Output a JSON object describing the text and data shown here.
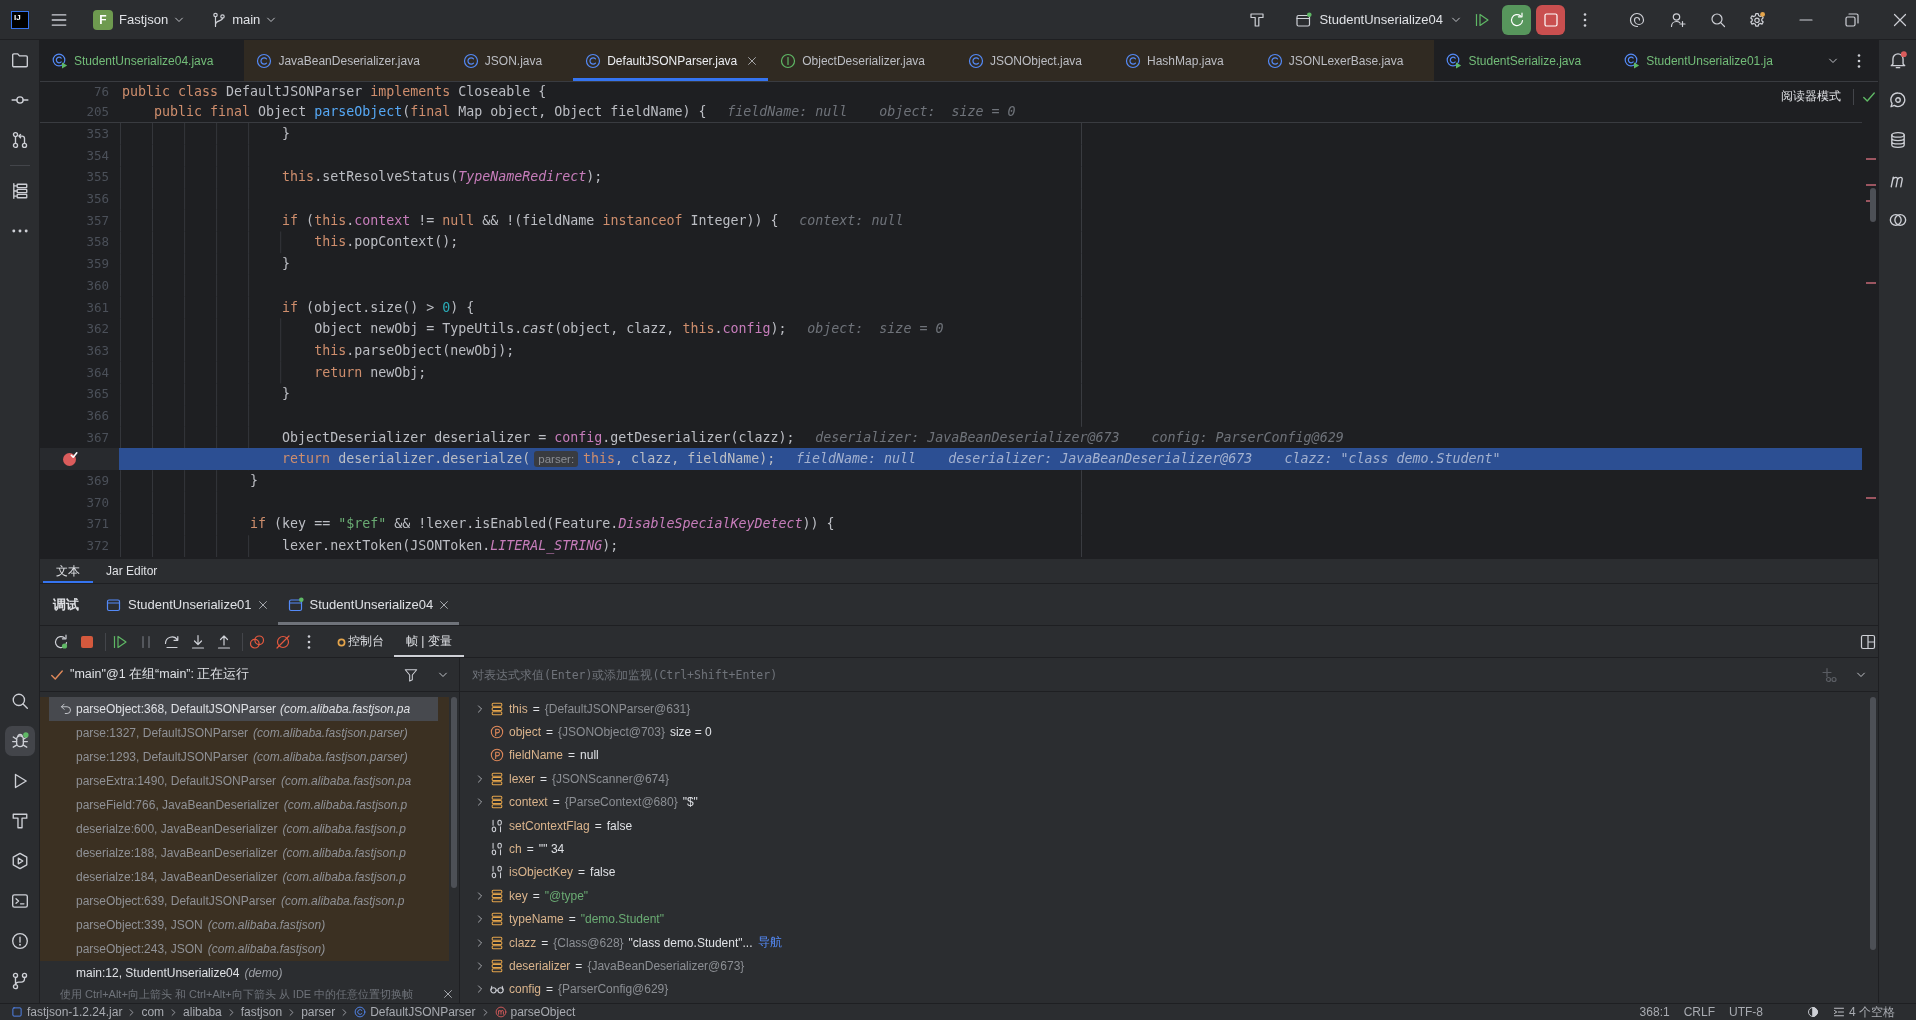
{
  "title_bar": {
    "logo": "IJ",
    "project_initial": "F",
    "project": "Fastjson",
    "branch": "main",
    "run_config": "StudentUnserialize04"
  },
  "tool_strip": {
    "top": [
      {
        "selected": false
      },
      {
        "selected": false
      },
      {
        "selected": false
      },
      {
        "selected": false
      },
      {
        "selected": false
      }
    ],
    "bottom": [
      {
        "selected": false
      },
      {
        "selected": true
      },
      {
        "selected": false
      },
      {
        "selected": false
      },
      {
        "selected": false
      },
      {
        "selected": false
      },
      {
        "selected": false
      },
      {
        "selected": false
      }
    ]
  },
  "editor_tabs": [
    {
      "label": "StudentUnserialize04.java",
      "kind": "runnable",
      "library": false,
      "selected": false
    },
    {
      "label": "JavaBeanDeserializer.java",
      "kind": "class",
      "library": true,
      "selected": false
    },
    {
      "label": "JSON.java",
      "kind": "class",
      "library": true,
      "selected": false
    },
    {
      "label": "DefaultJSONParser.java",
      "kind": "class",
      "library": true,
      "selected": true
    },
    {
      "label": "ObjectDeserializer.java",
      "kind": "interface",
      "library": true,
      "selected": false
    },
    {
      "label": "JSONObject.java",
      "kind": "class",
      "library": true,
      "selected": false
    },
    {
      "label": "HashMap.java",
      "kind": "class",
      "library": true,
      "selected": false
    },
    {
      "label": "JSONLexerBase.java",
      "kind": "class",
      "library": true,
      "selected": false
    },
    {
      "label": "StudentSerialize.java",
      "kind": "runnable",
      "library": false,
      "selected": false
    },
    {
      "label": "StudentUnserialize01.ja",
      "kind": "runnable",
      "library": false,
      "selected": false
    }
  ],
  "editor": {
    "reader_mode": "阅读器模式",
    "sticky_lines": [
      {
        "number": "76",
        "tokens": [
          {
            "kind": "keyword",
            "text": "public class"
          },
          {
            "kind": "plain",
            "text": " DefaultJSONParser "
          },
          {
            "kind": "keyword",
            "text": "implements"
          },
          {
            "kind": "plain",
            "text": " Closeable {"
          }
        ]
      },
      {
        "number": "205",
        "tokens": [
          {
            "kind": "keyword",
            "text": "    public final"
          },
          {
            "kind": "plain",
            "text": " Object "
          },
          {
            "kind": "method",
            "text": "parseObject"
          },
          {
            "kind": "plain",
            "text": "("
          },
          {
            "kind": "keyword",
            "text": "final"
          },
          {
            "kind": "plain",
            "text": " Map object, Object fieldName) {"
          }
        ],
        "hints": [
          "fieldName: null",
          "object:  size = 0"
        ]
      }
    ],
    "lines": [
      {
        "number": "353",
        "current": false,
        "breakpoint": false,
        "tokens": [
          {
            "kind": "plain",
            "text": "                    }"
          }
        ]
      },
      {
        "number": "354",
        "current": false,
        "breakpoint": false
      },
      {
        "number": "355",
        "current": false,
        "breakpoint": false,
        "tokens": [
          {
            "kind": "keyword",
            "text": "                    this"
          },
          {
            "kind": "plain",
            "text": ".setResolveStatus("
          },
          {
            "kind": "static",
            "text": "TypeNameRedirect"
          },
          {
            "kind": "plain",
            "text": ");"
          }
        ]
      },
      {
        "number": "356",
        "current": false,
        "breakpoint": false
      },
      {
        "number": "357",
        "current": false,
        "breakpoint": false,
        "tokens": [
          {
            "kind": "keyword",
            "text": "                    if"
          },
          {
            "kind": "plain",
            "text": " ("
          },
          {
            "kind": "keyword",
            "text": "this"
          },
          {
            "kind": "plain",
            "text": "."
          },
          {
            "kind": "field",
            "text": "context"
          },
          {
            "kind": "plain",
            "text": " != "
          },
          {
            "kind": "keyword",
            "text": "null"
          },
          {
            "kind": "plain",
            "text": " && !(fieldName "
          },
          {
            "kind": "keyword",
            "text": "instanceof"
          },
          {
            "kind": "plain",
            "text": " Integer)) {"
          }
        ],
        "hints": [
          "context: null"
        ]
      },
      {
        "number": "358",
        "current": false,
        "breakpoint": false,
        "tokens": [
          {
            "kind": "keyword",
            "text": "                        this"
          },
          {
            "kind": "plain",
            "text": ".popContext();"
          }
        ]
      },
      {
        "number": "359",
        "current": false,
        "breakpoint": false,
        "tokens": [
          {
            "kind": "plain",
            "text": "                    }"
          }
        ]
      },
      {
        "number": "360",
        "current": false,
        "breakpoint": false
      },
      {
        "number": "361",
        "current": false,
        "breakpoint": false,
        "tokens": [
          {
            "kind": "keyword",
            "text": "                    if"
          },
          {
            "kind": "plain",
            "text": " (object.size() > "
          },
          {
            "kind": "number",
            "text": "0"
          },
          {
            "kind": "plain",
            "text": ") {"
          }
        ]
      },
      {
        "number": "362",
        "current": false,
        "breakpoint": false,
        "tokens": [
          {
            "kind": "plain",
            "text": "                        Object newObj = TypeUtils."
          },
          {
            "kind": "italic",
            "text": "cast"
          },
          {
            "kind": "plain",
            "text": "(object, clazz, "
          },
          {
            "kind": "keyword",
            "text": "this"
          },
          {
            "kind": "plain",
            "text": "."
          },
          {
            "kind": "field",
            "text": "config"
          },
          {
            "kind": "plain",
            "text": ");"
          }
        ],
        "hints": [
          "object:  size = 0"
        ]
      },
      {
        "number": "363",
        "current": false,
        "breakpoint": false,
        "tokens": [
          {
            "kind": "keyword",
            "text": "                        this"
          },
          {
            "kind": "plain",
            "text": ".parseObject(newObj);"
          }
        ]
      },
      {
        "number": "364",
        "current": false,
        "breakpoint": false,
        "tokens": [
          {
            "kind": "keyword",
            "text": "                        return"
          },
          {
            "kind": "plain",
            "text": " newObj;"
          }
        ]
      },
      {
        "number": "365",
        "current": false,
        "breakpoint": false,
        "tokens": [
          {
            "kind": "plain",
            "text": "                    }"
          }
        ]
      },
      {
        "number": "366",
        "current": false,
        "breakpoint": false
      },
      {
        "number": "367",
        "current": false,
        "breakpoint": false,
        "tokens": [
          {
            "kind": "plain",
            "text": "                    ObjectDeserializer deserializer = "
          },
          {
            "kind": "field",
            "text": "config"
          },
          {
            "kind": "plain",
            "text": ".getDeserializer(clazz);"
          }
        ],
        "hints": [
          "deserializer: JavaBeanDeserializer@673",
          "config: ParserConfig@629"
        ]
      },
      {
        "current": true,
        "breakpoint": true,
        "tokens": [
          {
            "kind": "keyword",
            "text": "                    return"
          },
          {
            "kind": "plain",
            "text": " deserializer.deserialze("
          },
          {
            "kind": "inlay",
            "text": "parser:"
          },
          {
            "kind": "keyword",
            "text": "this"
          },
          {
            "kind": "plain",
            "text": ", clazz, fieldName);"
          }
        ],
        "hints": [
          "fieldName: null",
          "deserializer: JavaBeanDeserializer@673",
          "clazz: \"class demo.Student\""
        ]
      },
      {
        "number": "369",
        "current": false,
        "breakpoint": false,
        "tokens": [
          {
            "kind": "plain",
            "text": "                }"
          }
        ]
      },
      {
        "number": "370",
        "current": false,
        "breakpoint": false
      },
      {
        "number": "371",
        "current": false,
        "breakpoint": false,
        "tokens": [
          {
            "kind": "keyword",
            "text": "                if"
          },
          {
            "kind": "plain",
            "text": " (key == "
          },
          {
            "kind": "string",
            "text": "\"$ref\""
          },
          {
            "kind": "plain",
            "text": " && !lexer.isEnabled(Feature."
          },
          {
            "kind": "static",
            "text": "DisableSpecialKeyDetect"
          },
          {
            "kind": "plain",
            "text": ")) {"
          }
        ]
      },
      {
        "number": "372",
        "current": false,
        "breakpoint": false,
        "tokens": [
          {
            "kind": "plain",
            "text": "                    lexer.nextToken(JSONToken."
          },
          {
            "kind": "static",
            "text": "LITERAL_STRING"
          },
          {
            "kind": "plain",
            "text": ");"
          }
        ]
      }
    ]
  },
  "editor_bottom_tabs": [
    {
      "label": "文本",
      "selected": true
    },
    {
      "label": "Jar Editor",
      "selected": false
    }
  ],
  "debug": {
    "title": "调试",
    "sessions": [
      {
        "label": "StudentUnserialize01",
        "selected": false,
        "running": false
      },
      {
        "label": "StudentUnserialize04",
        "selected": true,
        "running": true
      }
    ],
    "views": [
      {
        "label": "控制台",
        "kind": "console",
        "selected": false
      },
      {
        "label": "帧 | 变量",
        "kind": "frames",
        "selected": true
      }
    ],
    "thread": "\"main\"@1 在组“main”: 正在运行",
    "frames": [
      {
        "method": "parseObject:368, DefaultJSONParser",
        "package": "(com.alibaba.fastjson.pa",
        "library": true,
        "selected": true
      },
      {
        "method": "parse:1327, DefaultJSONParser",
        "package": "(com.alibaba.fastjson.parser)",
        "library": true,
        "selected": false
      },
      {
        "method": "parse:1293, DefaultJSONParser",
        "package": "(com.alibaba.fastjson.parser)",
        "library": true,
        "selected": false
      },
      {
        "method": "parseExtra:1490, DefaultJSONParser",
        "package": "(com.alibaba.fastjson.pa",
        "library": true,
        "selected": false
      },
      {
        "method": "parseField:766, JavaBeanDeserializer",
        "package": "(com.alibaba.fastjson.p",
        "library": true,
        "selected": false
      },
      {
        "method": "deserialze:600, JavaBeanDeserializer",
        "package": "(com.alibaba.fastjson.p",
        "library": true,
        "selected": false
      },
      {
        "method": "deserialze:188, JavaBeanDeserializer",
        "package": "(com.alibaba.fastjson.p",
        "library": true,
        "selected": false
      },
      {
        "method": "deserialze:184, JavaBeanDeserializer",
        "package": "(com.alibaba.fastjson.p",
        "library": true,
        "selected": false
      },
      {
        "method": "parseObject:639, DefaultJSONParser",
        "package": "(com.alibaba.fastjson.p",
        "library": true,
        "selected": false
      },
      {
        "method": "parseObject:339, JSON",
        "package": "(com.alibaba.fastjson)",
        "library": true,
        "selected": false
      },
      {
        "method": "parseObject:243, JSON",
        "package": "(com.alibaba.fastjson)",
        "library": true,
        "selected": false
      },
      {
        "method": "main:12, StudentUnserialize04",
        "package": "(demo)",
        "library": false,
        "selected": false
      }
    ],
    "frames_tip": "使用 Ctrl+Alt+向上箭头 和 Ctrl+Alt+向下箭头 从 IDE 中的任意位置切换帧",
    "evaluate_placeholder": "对表达式求值(Enter)或添加监视(Ctrl+Shift+Enter)",
    "variables": [
      {
        "name": "this",
        "kind": "field",
        "expandable": true,
        "parts": [
          {
            "kind": "text",
            "text": "="
          },
          {
            "kind": "ref",
            "text": "{DefaultJSONParser@631}"
          }
        ]
      },
      {
        "name": "object",
        "kind": "param",
        "expandable": false,
        "parts": [
          {
            "kind": "text",
            "text": "="
          },
          {
            "kind": "ref",
            "text": "{JSONObject@703}"
          },
          {
            "kind": "text",
            "text": "size = 0"
          }
        ]
      },
      {
        "name": "fieldName",
        "kind": "param",
        "expandable": false,
        "parts": [
          {
            "kind": "text",
            "text": "="
          },
          {
            "kind": "text",
            "text": "null"
          }
        ]
      },
      {
        "name": "lexer",
        "kind": "field",
        "expandable": true,
        "parts": [
          {
            "kind": "text",
            "text": "="
          },
          {
            "kind": "ref",
            "text": "{JSONScanner@674}"
          }
        ]
      },
      {
        "name": "context",
        "kind": "field",
        "expandable": true,
        "parts": [
          {
            "kind": "text",
            "text": "="
          },
          {
            "kind": "ref",
            "text": "{ParseContext@680}"
          },
          {
            "kind": "text",
            "text": "\"$\""
          }
        ]
      },
      {
        "name": "setContextFlag",
        "kind": "primitive",
        "expandable": false,
        "parts": [
          {
            "kind": "text",
            "text": "="
          },
          {
            "kind": "text",
            "text": "false"
          }
        ]
      },
      {
        "name": "ch",
        "kind": "primitive",
        "expandable": false,
        "parts": [
          {
            "kind": "text",
            "text": "="
          },
          {
            "kind": "text",
            "text": "'\"' 34"
          }
        ]
      },
      {
        "name": "isObjectKey",
        "kind": "primitive",
        "expandable": false,
        "parts": [
          {
            "kind": "text",
            "text": "="
          },
          {
            "kind": "text",
            "text": "false"
          }
        ]
      },
      {
        "name": "key",
        "kind": "field",
        "expandable": true,
        "parts": [
          {
            "kind": "text",
            "text": "="
          },
          {
            "kind": "string",
            "text": "\"@type\""
          }
        ]
      },
      {
        "name": "typeName",
        "kind": "field",
        "expandable": true,
        "parts": [
          {
            "kind": "text",
            "text": "="
          },
          {
            "kind": "string",
            "text": "\"demo.Student\""
          }
        ]
      },
      {
        "name": "clazz",
        "kind": "field",
        "expandable": true,
        "parts": [
          {
            "kind": "text",
            "text": "="
          },
          {
            "kind": "ref",
            "text": "{Class@628}"
          },
          {
            "kind": "text",
            "text": "\"class demo.Student\"..."
          },
          {
            "kind": "link",
            "text": "导航"
          }
        ]
      },
      {
        "name": "deserializer",
        "kind": "field",
        "expandable": true,
        "parts": [
          {
            "kind": "text",
            "text": "="
          },
          {
            "kind": "ref",
            "text": "{JavaBeanDeserializer@673}"
          }
        ]
      },
      {
        "name": "config",
        "kind": "watch",
        "expandable": true,
        "parts": [
          {
            "kind": "text",
            "text": "="
          },
          {
            "kind": "ref",
            "text": "{ParserConfig@629}"
          }
        ]
      }
    ]
  },
  "status_bar": {
    "breadcrumbs": [
      {
        "label": "fastjson-1.2.24.jar",
        "kind": "jar"
      },
      {
        "label": "com",
        "kind": "package"
      },
      {
        "label": "alibaba",
        "kind": "package"
      },
      {
        "label": "fastjson",
        "kind": "package"
      },
      {
        "label": "parser",
        "kind": "package"
      },
      {
        "label": "DefaultJSONParser",
        "kind": "class"
      },
      {
        "label": "parseObject",
        "kind": "method"
      }
    ],
    "items": [
      {
        "label": "368:1",
        "kind": "plain"
      },
      {
        "label": "CRLF",
        "kind": "plain"
      },
      {
        "label": "UTF-8",
        "kind": "plain"
      },
      {
        "label": "4 个空格",
        "kind": "indent"
      }
    ]
  }
}
